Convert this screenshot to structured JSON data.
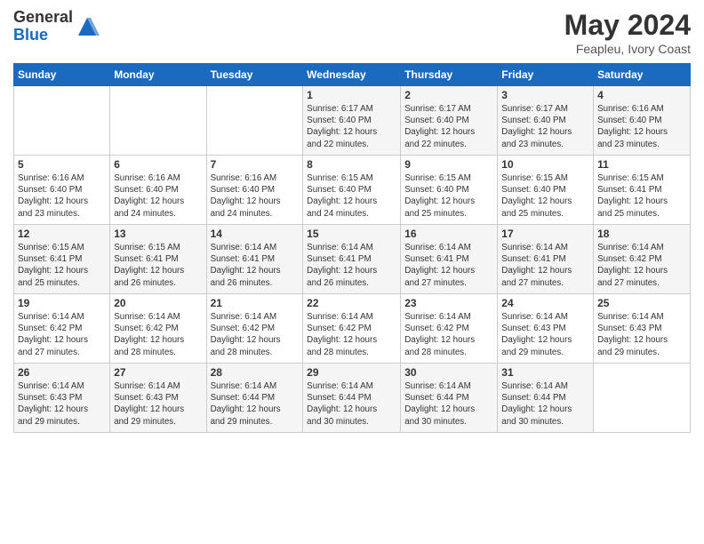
{
  "logo": {
    "general": "General",
    "blue": "Blue"
  },
  "header": {
    "month_year": "May 2024",
    "location": "Feapleu, Ivory Coast"
  },
  "weekdays": [
    "Sunday",
    "Monday",
    "Tuesday",
    "Wednesday",
    "Thursday",
    "Friday",
    "Saturday"
  ],
  "weeks": [
    [
      {
        "day": "",
        "info": ""
      },
      {
        "day": "",
        "info": ""
      },
      {
        "day": "",
        "info": ""
      },
      {
        "day": "1",
        "info": "Sunrise: 6:17 AM\nSunset: 6:40 PM\nDaylight: 12 hours\nand 22 minutes."
      },
      {
        "day": "2",
        "info": "Sunrise: 6:17 AM\nSunset: 6:40 PM\nDaylight: 12 hours\nand 22 minutes."
      },
      {
        "day": "3",
        "info": "Sunrise: 6:17 AM\nSunset: 6:40 PM\nDaylight: 12 hours\nand 23 minutes."
      },
      {
        "day": "4",
        "info": "Sunrise: 6:16 AM\nSunset: 6:40 PM\nDaylight: 12 hours\nand 23 minutes."
      }
    ],
    [
      {
        "day": "5",
        "info": "Sunrise: 6:16 AM\nSunset: 6:40 PM\nDaylight: 12 hours\nand 23 minutes."
      },
      {
        "day": "6",
        "info": "Sunrise: 6:16 AM\nSunset: 6:40 PM\nDaylight: 12 hours\nand 24 minutes."
      },
      {
        "day": "7",
        "info": "Sunrise: 6:16 AM\nSunset: 6:40 PM\nDaylight: 12 hours\nand 24 minutes."
      },
      {
        "day": "8",
        "info": "Sunrise: 6:15 AM\nSunset: 6:40 PM\nDaylight: 12 hours\nand 24 minutes."
      },
      {
        "day": "9",
        "info": "Sunrise: 6:15 AM\nSunset: 6:40 PM\nDaylight: 12 hours\nand 25 minutes."
      },
      {
        "day": "10",
        "info": "Sunrise: 6:15 AM\nSunset: 6:40 PM\nDaylight: 12 hours\nand 25 minutes."
      },
      {
        "day": "11",
        "info": "Sunrise: 6:15 AM\nSunset: 6:41 PM\nDaylight: 12 hours\nand 25 minutes."
      }
    ],
    [
      {
        "day": "12",
        "info": "Sunrise: 6:15 AM\nSunset: 6:41 PM\nDaylight: 12 hours\nand 25 minutes."
      },
      {
        "day": "13",
        "info": "Sunrise: 6:15 AM\nSunset: 6:41 PM\nDaylight: 12 hours\nand 26 minutes."
      },
      {
        "day": "14",
        "info": "Sunrise: 6:14 AM\nSunset: 6:41 PM\nDaylight: 12 hours\nand 26 minutes."
      },
      {
        "day": "15",
        "info": "Sunrise: 6:14 AM\nSunset: 6:41 PM\nDaylight: 12 hours\nand 26 minutes."
      },
      {
        "day": "16",
        "info": "Sunrise: 6:14 AM\nSunset: 6:41 PM\nDaylight: 12 hours\nand 27 minutes."
      },
      {
        "day": "17",
        "info": "Sunrise: 6:14 AM\nSunset: 6:41 PM\nDaylight: 12 hours\nand 27 minutes."
      },
      {
        "day": "18",
        "info": "Sunrise: 6:14 AM\nSunset: 6:42 PM\nDaylight: 12 hours\nand 27 minutes."
      }
    ],
    [
      {
        "day": "19",
        "info": "Sunrise: 6:14 AM\nSunset: 6:42 PM\nDaylight: 12 hours\nand 27 minutes."
      },
      {
        "day": "20",
        "info": "Sunrise: 6:14 AM\nSunset: 6:42 PM\nDaylight: 12 hours\nand 28 minutes."
      },
      {
        "day": "21",
        "info": "Sunrise: 6:14 AM\nSunset: 6:42 PM\nDaylight: 12 hours\nand 28 minutes."
      },
      {
        "day": "22",
        "info": "Sunrise: 6:14 AM\nSunset: 6:42 PM\nDaylight: 12 hours\nand 28 minutes."
      },
      {
        "day": "23",
        "info": "Sunrise: 6:14 AM\nSunset: 6:42 PM\nDaylight: 12 hours\nand 28 minutes."
      },
      {
        "day": "24",
        "info": "Sunrise: 6:14 AM\nSunset: 6:43 PM\nDaylight: 12 hours\nand 29 minutes."
      },
      {
        "day": "25",
        "info": "Sunrise: 6:14 AM\nSunset: 6:43 PM\nDaylight: 12 hours\nand 29 minutes."
      }
    ],
    [
      {
        "day": "26",
        "info": "Sunrise: 6:14 AM\nSunset: 6:43 PM\nDaylight: 12 hours\nand 29 minutes."
      },
      {
        "day": "27",
        "info": "Sunrise: 6:14 AM\nSunset: 6:43 PM\nDaylight: 12 hours\nand 29 minutes."
      },
      {
        "day": "28",
        "info": "Sunrise: 6:14 AM\nSunset: 6:44 PM\nDaylight: 12 hours\nand 29 minutes."
      },
      {
        "day": "29",
        "info": "Sunrise: 6:14 AM\nSunset: 6:44 PM\nDaylight: 12 hours\nand 30 minutes."
      },
      {
        "day": "30",
        "info": "Sunrise: 6:14 AM\nSunset: 6:44 PM\nDaylight: 12 hours\nand 30 minutes."
      },
      {
        "day": "31",
        "info": "Sunrise: 6:14 AM\nSunset: 6:44 PM\nDaylight: 12 hours\nand 30 minutes."
      },
      {
        "day": "",
        "info": ""
      }
    ]
  ]
}
